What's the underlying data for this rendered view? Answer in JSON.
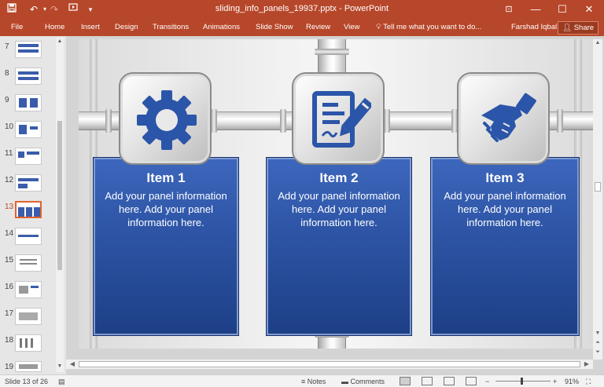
{
  "window": {
    "title": "sliding_info_panels_19937.pptx - PowerPoint",
    "controls": {
      "ribbon_display": "⊡",
      "minimize": "—",
      "maximize": "☐",
      "close": "✕"
    }
  },
  "quick_access": {
    "save_icon": "save-icon",
    "undo_icon": "undo-icon",
    "redo_icon": "redo-icon",
    "start_icon": "start-from-beginning-icon",
    "customize": "▾"
  },
  "ribbon": {
    "tabs": [
      "File",
      "Home",
      "Insert",
      "Design",
      "Transitions",
      "Animations",
      "Slide Show",
      "Review",
      "View"
    ],
    "tell_me": "Tell me what you want to do...",
    "user": "Farshad Iqbal",
    "share": "Share"
  },
  "thumbnails": {
    "numbers": [
      "7",
      "8",
      "9",
      "10",
      "11",
      "12",
      "13",
      "14",
      "15",
      "16",
      "17",
      "18",
      "19"
    ],
    "active": "13"
  },
  "slide": {
    "panels": [
      {
        "title": "Item 1",
        "text": "Add your panel information here. Add your panel information here.",
        "icon": "gear-icon"
      },
      {
        "title": "Item 2",
        "text": "Add your panel information here. Add your panel information here.",
        "icon": "document-edit-icon"
      },
      {
        "title": "Item 3",
        "text": "Add your panel information here. Add your panel information here.",
        "icon": "handshake-icon"
      }
    ],
    "colors": {
      "panel": "#2e55a6",
      "icon": "#2b55a8"
    }
  },
  "status": {
    "slide_info": "Slide 13 of 26",
    "notes": "Notes",
    "comments": "Comments",
    "zoom": "91%",
    "zoom_minus": "−",
    "zoom_plus": "+"
  }
}
